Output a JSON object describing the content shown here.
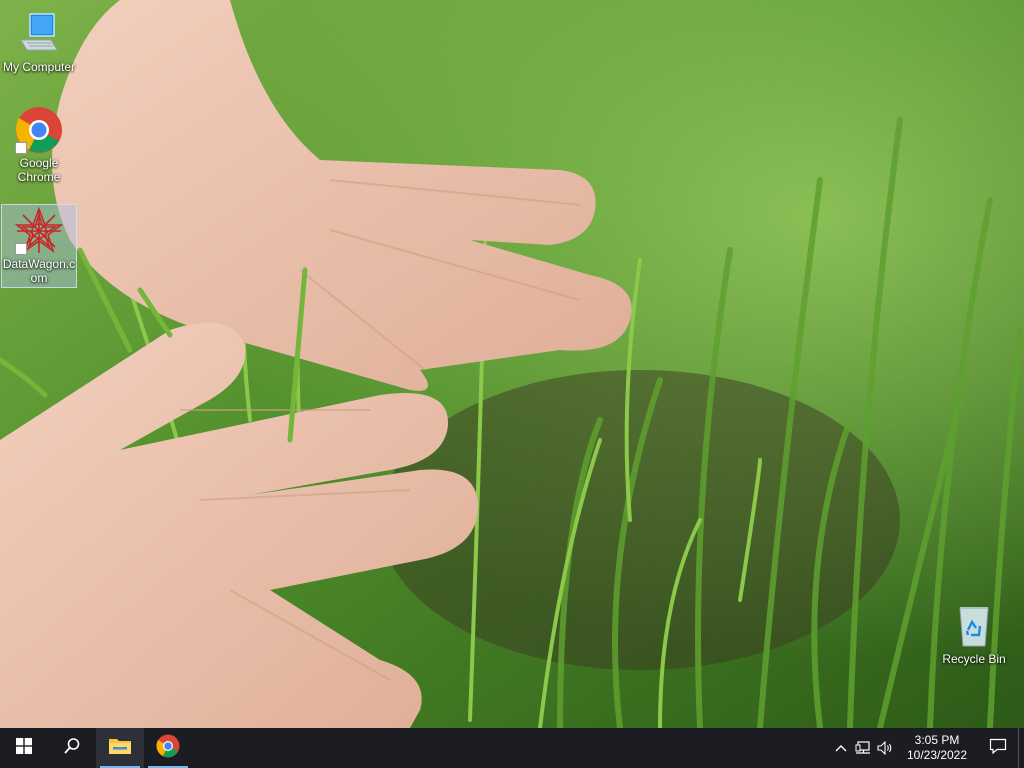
{
  "desktop": {
    "icons": [
      {
        "label": "My Computer",
        "icon": "computer-icon"
      },
      {
        "label": "Google Chrome",
        "icon": "chrome-icon"
      },
      {
        "label": "DataWagon.com",
        "icon": "datawagon-icon"
      },
      {
        "label": "Recycle Bin",
        "icon": "recycle-bin-icon"
      }
    ]
  },
  "taskbar": {
    "start_icon": "windows-start-icon",
    "search_icon": "search-icon",
    "pinned": [
      {
        "name": "File Explorer",
        "icon": "file-explorer-icon",
        "active": true
      },
      {
        "name": "Google Chrome",
        "icon": "chrome-icon",
        "active": false
      }
    ],
    "tray": {
      "icons": [
        "chevron-up-icon",
        "network-icon",
        "volume-icon"
      ],
      "time": "3:05 PM",
      "date": "10/23/2022",
      "notification_icon": "notification-icon"
    }
  },
  "colors": {
    "taskbar": "#1b1d22",
    "accent": "#76b9ed"
  }
}
